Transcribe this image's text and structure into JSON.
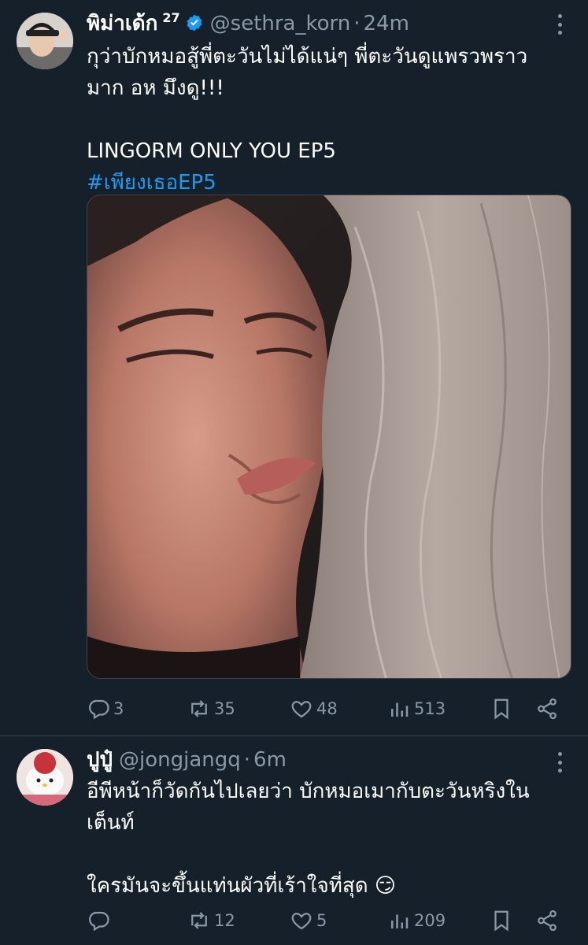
{
  "tweets": [
    {
      "name": "พิม่าเด้ก",
      "name_sup": "27",
      "handle": "@sethra_korn",
      "time": "24m",
      "text_line": "กุว่าบักหมอสู้พี่ตะวันไม่ได้แน่ๆ พี่ตะวันดูแพรวพราว\nมาก อห มึงดู!!!\n\nLINGORM ONLY YOU EP5",
      "hashtag": "#เพียงเธอEP5",
      "stats": {
        "replies": "3",
        "retweets": "35",
        "likes": "48",
        "views": "513"
      }
    },
    {
      "name": "ปูปู๋",
      "handle": "@jongjangq",
      "time": "6m",
      "text_line": "อีพีหน้าก็วัดกันไปเลยว่า บักหมอเมากับตะวันหริงใน\nเต็นท์\n\nใครมันจะขึ้นแท่นผัวที่เร้าใจที่สุด 😏",
      "stats": {
        "replies": "",
        "retweets": "12",
        "likes": "5",
        "views": "209"
      }
    }
  ],
  "dot_separator": "·",
  "colors": {
    "background": "#15202b",
    "muted": "#8b98a5",
    "link": "#1d9bf0",
    "verified": "#1d9bf0"
  }
}
